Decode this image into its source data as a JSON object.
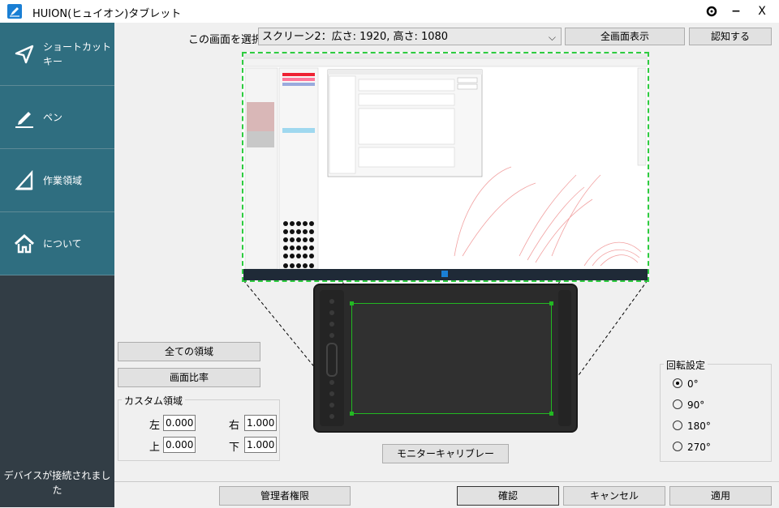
{
  "app": {
    "title": "HUION(ヒュイオン)タブレット"
  },
  "titlebar": {
    "settings_icon": "gear-icon",
    "minimize": "−",
    "close": "X"
  },
  "sidebar": {
    "items": [
      {
        "label": "ショートカットキー",
        "icon": "send-icon"
      },
      {
        "label": "ペン",
        "icon": "pen-icon"
      },
      {
        "label": "作業領域",
        "icon": "triangle-icon"
      },
      {
        "label": "について",
        "icon": "home-icon"
      }
    ],
    "status": "デバイスが接続されました"
  },
  "screen": {
    "label": "この画面を選択",
    "selected": "スクリーン2：広さ: 1920, 高さ: 1080",
    "fullscreen_button": "全画面表示",
    "identify_button": "認知する"
  },
  "area": {
    "all_area_button": "全ての領域",
    "aspect_button": "画面比率",
    "custom_title": "カスタム領域",
    "left_label": "左",
    "left_value": "0.000",
    "right_label": "右",
    "right_value": "1.000",
    "top_label": "上",
    "top_value": "0.000",
    "bottom_label": "下",
    "bottom_value": "1.000",
    "calibrate_button": "モニターキャリブレー"
  },
  "rotation": {
    "title": "回転設定",
    "options": [
      "0°",
      "90°",
      "180°",
      "270°"
    ],
    "selected": "0°"
  },
  "footer": {
    "admin_button": "管理者権限",
    "ok_button": "確認",
    "cancel_button": "キャンセル",
    "apply_button": "適用"
  },
  "colors": {
    "accent": "#2f6e80",
    "sidebar_bg": "#323d45",
    "area_border": "#22b822"
  }
}
